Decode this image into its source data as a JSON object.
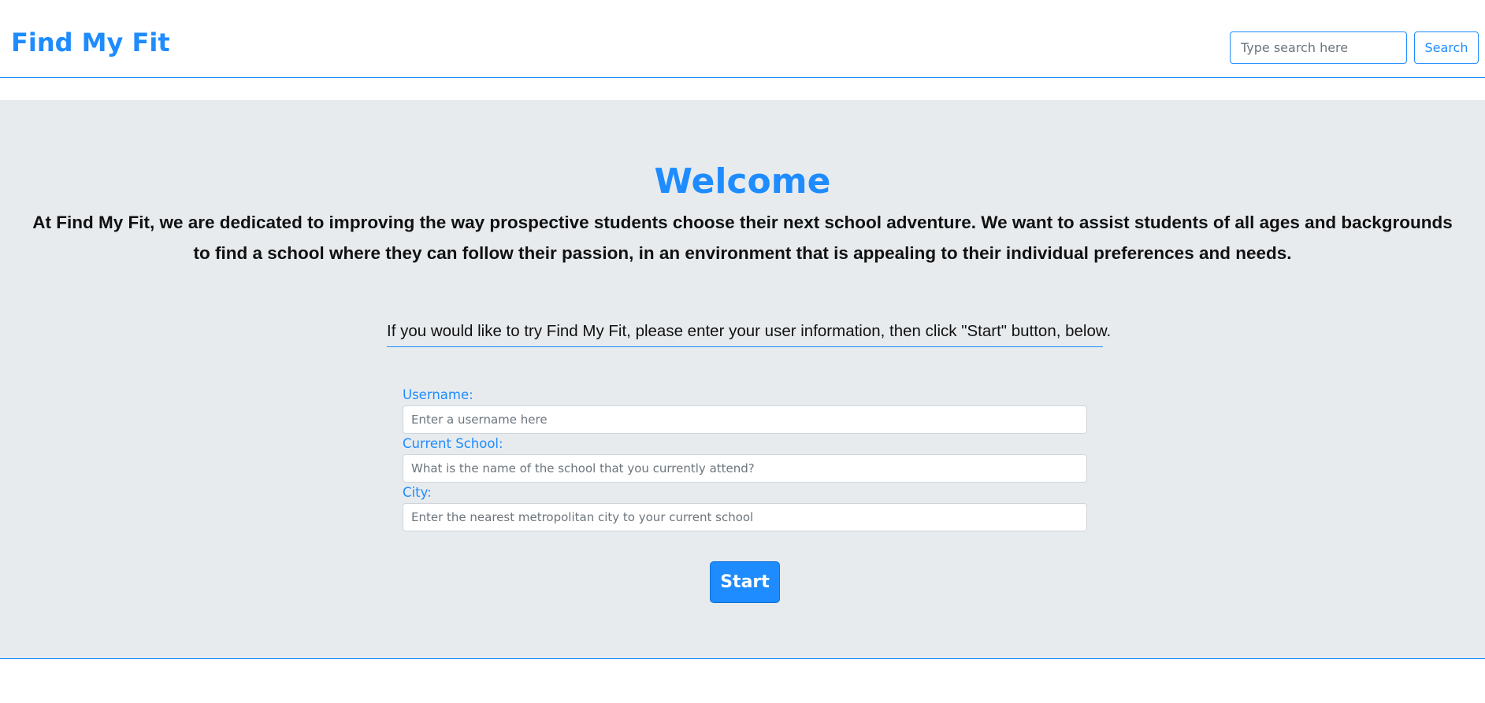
{
  "header": {
    "brand": "Find My Fit",
    "search": {
      "placeholder": "Type search here",
      "value": "",
      "button_label": "Search"
    }
  },
  "hero": {
    "title": "Welcome",
    "mission": "At Find My Fit, we are dedicated to improving the way prospective students choose their next school adventure. We want to assist students of all ages and backgrounds to find a school where they can follow their passion, in an environment that is appealing to their individual preferences and needs.",
    "instructions": "If you would like to try Find My Fit, please enter your user information, then click \"Start\" button, below."
  },
  "form": {
    "fields": [
      {
        "label": "Username:",
        "placeholder": "Enter a username here",
        "value": ""
      },
      {
        "label": "Current School:",
        "placeholder": "What is the name of the school that you currently attend?",
        "value": ""
      },
      {
        "label": "City:",
        "placeholder": "Enter the nearest metropolitan city to your current school",
        "value": ""
      }
    ],
    "start_label": "Start"
  },
  "colors": {
    "accent": "#1e8cff",
    "hero_background": "#e7ebee",
    "text": "#111111"
  }
}
